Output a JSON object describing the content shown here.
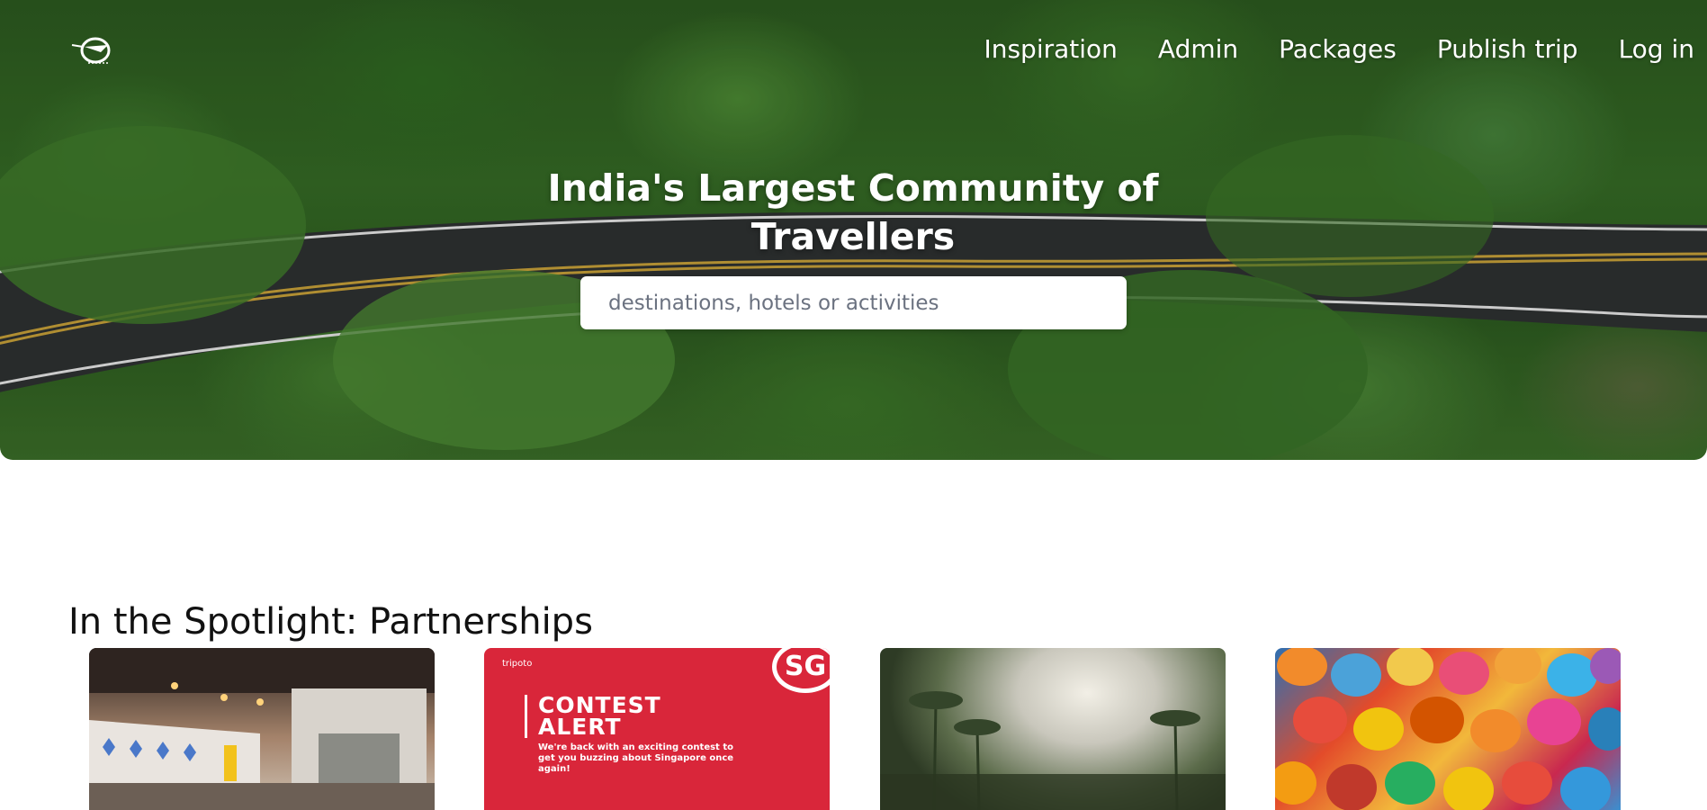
{
  "nav": {
    "logo_icon": "globe-airplane-logo",
    "items": [
      {
        "label": "Inspiration"
      },
      {
        "label": "Admin"
      },
      {
        "label": "Packages"
      },
      {
        "label": "Publish trip"
      },
      {
        "label": "Log in"
      }
    ]
  },
  "hero": {
    "headline": "India's Largest Community of Travellers",
    "search_placeholder": "destinations, hotels or activities"
  },
  "spotlight": {
    "title": "In the Spotlight: Partnerships",
    "cards": [
      {
        "image": "hostel-common-room-with-projector"
      },
      {
        "image": "contest-alert-banner",
        "brand": "tripoto",
        "badge": "SG",
        "heading": "CONTEST\nALERT",
        "text": "We're back with an exciting contest to get you buzzing about Singapore once again!"
      },
      {
        "image": "misty-palm-forest"
      },
      {
        "image": "colorful-hanging-lanterns"
      }
    ]
  },
  "colors": {
    "hero_text": "#ffffff",
    "contest_red": "#d9263a",
    "title_text": "#111111"
  }
}
